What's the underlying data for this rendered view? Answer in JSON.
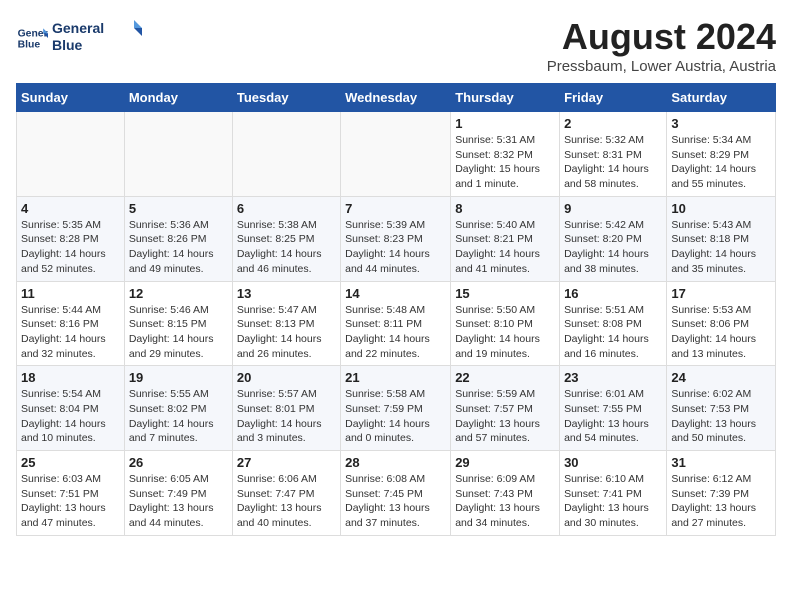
{
  "header": {
    "logo_line1": "General",
    "logo_line2": "Blue",
    "title": "August 2024",
    "subtitle": "Pressbaum, Lower Austria, Austria"
  },
  "days_of_week": [
    "Sunday",
    "Monday",
    "Tuesday",
    "Wednesday",
    "Thursday",
    "Friday",
    "Saturday"
  ],
  "weeks": [
    [
      {
        "day": "",
        "info": ""
      },
      {
        "day": "",
        "info": ""
      },
      {
        "day": "",
        "info": ""
      },
      {
        "day": "",
        "info": ""
      },
      {
        "day": "1",
        "info": "Sunrise: 5:31 AM\nSunset: 8:32 PM\nDaylight: 15 hours\nand 1 minute."
      },
      {
        "day": "2",
        "info": "Sunrise: 5:32 AM\nSunset: 8:31 PM\nDaylight: 14 hours\nand 58 minutes."
      },
      {
        "day": "3",
        "info": "Sunrise: 5:34 AM\nSunset: 8:29 PM\nDaylight: 14 hours\nand 55 minutes."
      }
    ],
    [
      {
        "day": "4",
        "info": "Sunrise: 5:35 AM\nSunset: 8:28 PM\nDaylight: 14 hours\nand 52 minutes."
      },
      {
        "day": "5",
        "info": "Sunrise: 5:36 AM\nSunset: 8:26 PM\nDaylight: 14 hours\nand 49 minutes."
      },
      {
        "day": "6",
        "info": "Sunrise: 5:38 AM\nSunset: 8:25 PM\nDaylight: 14 hours\nand 46 minutes."
      },
      {
        "day": "7",
        "info": "Sunrise: 5:39 AM\nSunset: 8:23 PM\nDaylight: 14 hours\nand 44 minutes."
      },
      {
        "day": "8",
        "info": "Sunrise: 5:40 AM\nSunset: 8:21 PM\nDaylight: 14 hours\nand 41 minutes."
      },
      {
        "day": "9",
        "info": "Sunrise: 5:42 AM\nSunset: 8:20 PM\nDaylight: 14 hours\nand 38 minutes."
      },
      {
        "day": "10",
        "info": "Sunrise: 5:43 AM\nSunset: 8:18 PM\nDaylight: 14 hours\nand 35 minutes."
      }
    ],
    [
      {
        "day": "11",
        "info": "Sunrise: 5:44 AM\nSunset: 8:16 PM\nDaylight: 14 hours\nand 32 minutes."
      },
      {
        "day": "12",
        "info": "Sunrise: 5:46 AM\nSunset: 8:15 PM\nDaylight: 14 hours\nand 29 minutes."
      },
      {
        "day": "13",
        "info": "Sunrise: 5:47 AM\nSunset: 8:13 PM\nDaylight: 14 hours\nand 26 minutes."
      },
      {
        "day": "14",
        "info": "Sunrise: 5:48 AM\nSunset: 8:11 PM\nDaylight: 14 hours\nand 22 minutes."
      },
      {
        "day": "15",
        "info": "Sunrise: 5:50 AM\nSunset: 8:10 PM\nDaylight: 14 hours\nand 19 minutes."
      },
      {
        "day": "16",
        "info": "Sunrise: 5:51 AM\nSunset: 8:08 PM\nDaylight: 14 hours\nand 16 minutes."
      },
      {
        "day": "17",
        "info": "Sunrise: 5:53 AM\nSunset: 8:06 PM\nDaylight: 14 hours\nand 13 minutes."
      }
    ],
    [
      {
        "day": "18",
        "info": "Sunrise: 5:54 AM\nSunset: 8:04 PM\nDaylight: 14 hours\nand 10 minutes."
      },
      {
        "day": "19",
        "info": "Sunrise: 5:55 AM\nSunset: 8:02 PM\nDaylight: 14 hours\nand 7 minutes."
      },
      {
        "day": "20",
        "info": "Sunrise: 5:57 AM\nSunset: 8:01 PM\nDaylight: 14 hours\nand 3 minutes."
      },
      {
        "day": "21",
        "info": "Sunrise: 5:58 AM\nSunset: 7:59 PM\nDaylight: 14 hours\nand 0 minutes."
      },
      {
        "day": "22",
        "info": "Sunrise: 5:59 AM\nSunset: 7:57 PM\nDaylight: 13 hours\nand 57 minutes."
      },
      {
        "day": "23",
        "info": "Sunrise: 6:01 AM\nSunset: 7:55 PM\nDaylight: 13 hours\nand 54 minutes."
      },
      {
        "day": "24",
        "info": "Sunrise: 6:02 AM\nSunset: 7:53 PM\nDaylight: 13 hours\nand 50 minutes."
      }
    ],
    [
      {
        "day": "25",
        "info": "Sunrise: 6:03 AM\nSunset: 7:51 PM\nDaylight: 13 hours\nand 47 minutes."
      },
      {
        "day": "26",
        "info": "Sunrise: 6:05 AM\nSunset: 7:49 PM\nDaylight: 13 hours\nand 44 minutes."
      },
      {
        "day": "27",
        "info": "Sunrise: 6:06 AM\nSunset: 7:47 PM\nDaylight: 13 hours\nand 40 minutes."
      },
      {
        "day": "28",
        "info": "Sunrise: 6:08 AM\nSunset: 7:45 PM\nDaylight: 13 hours\nand 37 minutes."
      },
      {
        "day": "29",
        "info": "Sunrise: 6:09 AM\nSunset: 7:43 PM\nDaylight: 13 hours\nand 34 minutes."
      },
      {
        "day": "30",
        "info": "Sunrise: 6:10 AM\nSunset: 7:41 PM\nDaylight: 13 hours\nand 30 minutes."
      },
      {
        "day": "31",
        "info": "Sunrise: 6:12 AM\nSunset: 7:39 PM\nDaylight: 13 hours\nand 27 minutes."
      }
    ]
  ]
}
